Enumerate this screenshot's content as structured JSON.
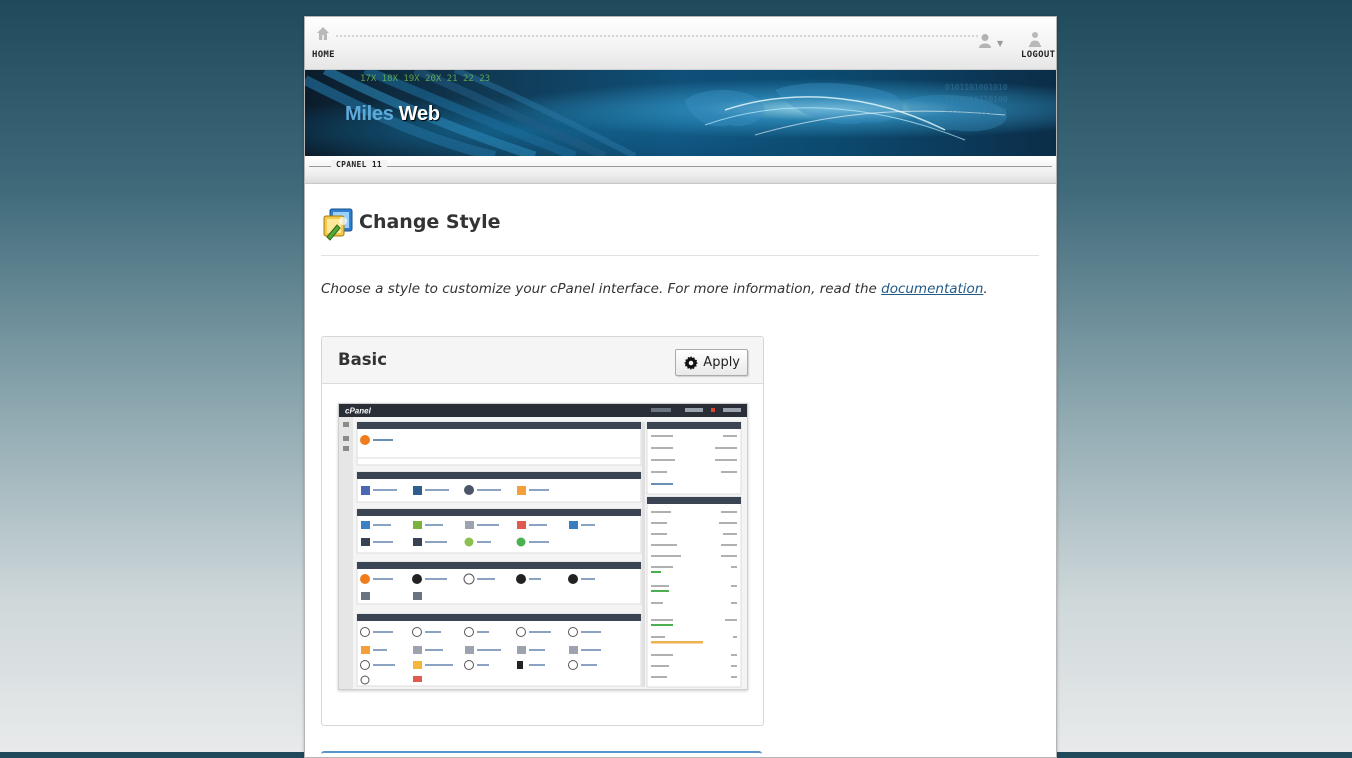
{
  "topbar": {
    "home_label": "HOME",
    "logout_label": "LOGOUT",
    "icons": {
      "home": "home-icon",
      "user": "user-icon",
      "logout": "logout-icon"
    }
  },
  "banner": {
    "logo_part1": "Miles",
    "logo_part2": "Web"
  },
  "tab": {
    "label": "CPANEL 11"
  },
  "page": {
    "title": "Change Style",
    "description_prefix": "Choose a style to customize your cPanel interface. For more information, read the ",
    "description_link": "documentation",
    "description_suffix": "."
  },
  "styles": [
    {
      "name": "Basic",
      "apply_label": "Apply"
    }
  ],
  "colors": {
    "link": "#225a88",
    "preview_header": "#2a2f37",
    "accent_blue": "#5c95c9"
  }
}
